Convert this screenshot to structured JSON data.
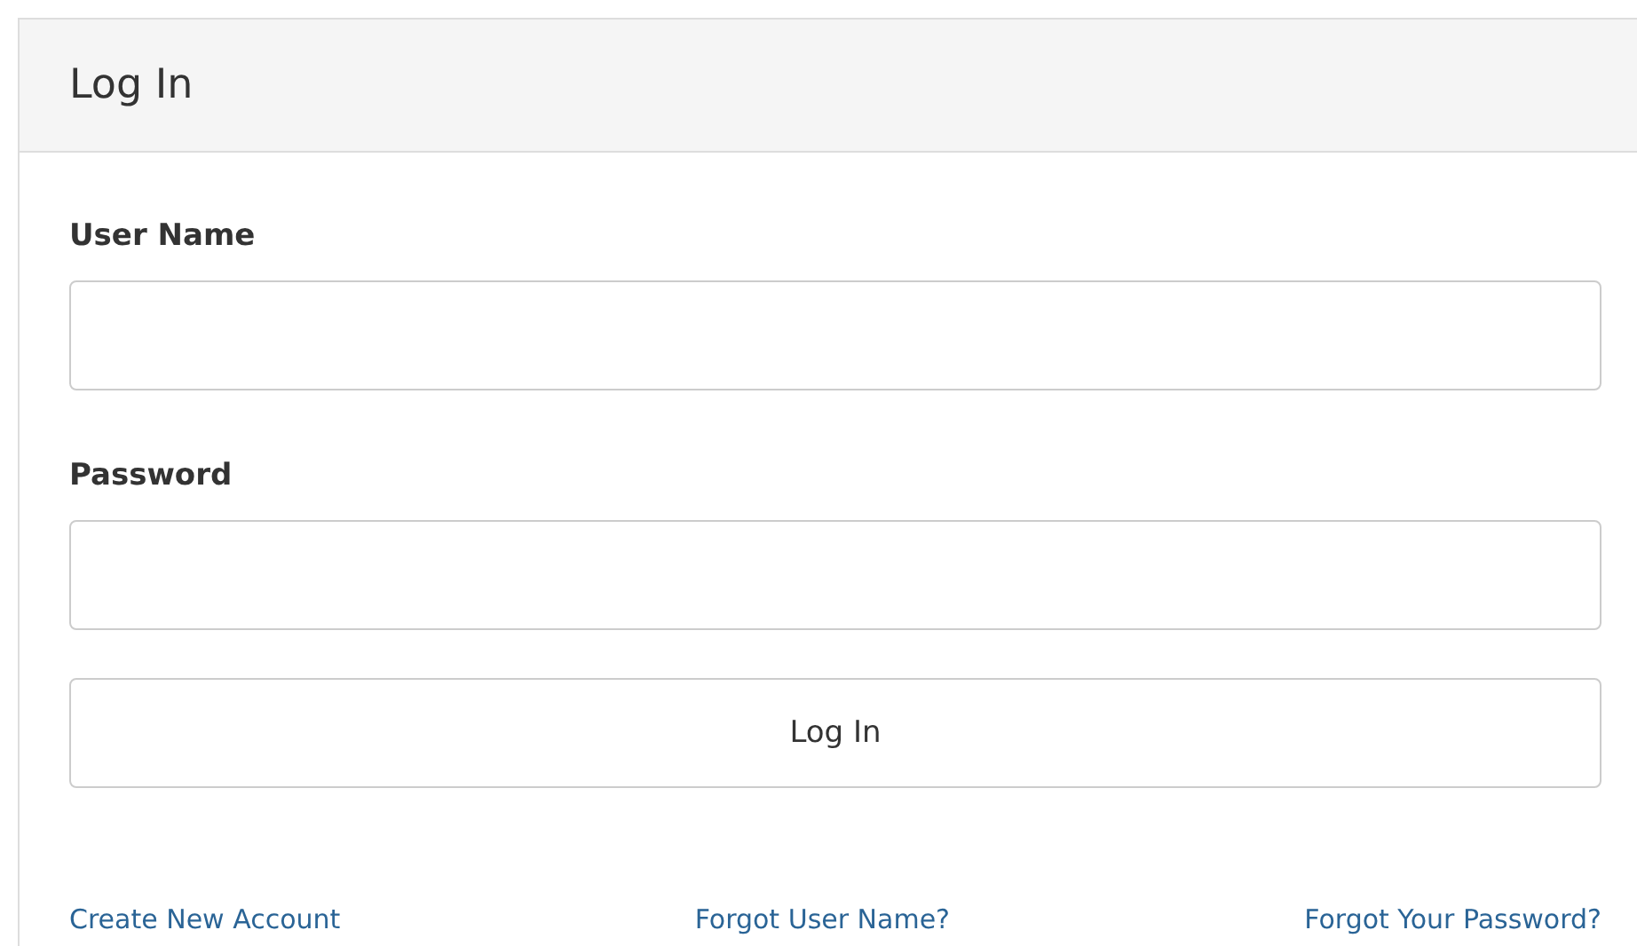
{
  "panel": {
    "title": "Log In"
  },
  "fields": [
    {
      "label": "User Name"
    },
    {
      "label": "Password"
    }
  ],
  "submit": "Log In",
  "links": [
    "Create New Account",
    "Forgot User Name?",
    "Forgot Your Password?"
  ]
}
